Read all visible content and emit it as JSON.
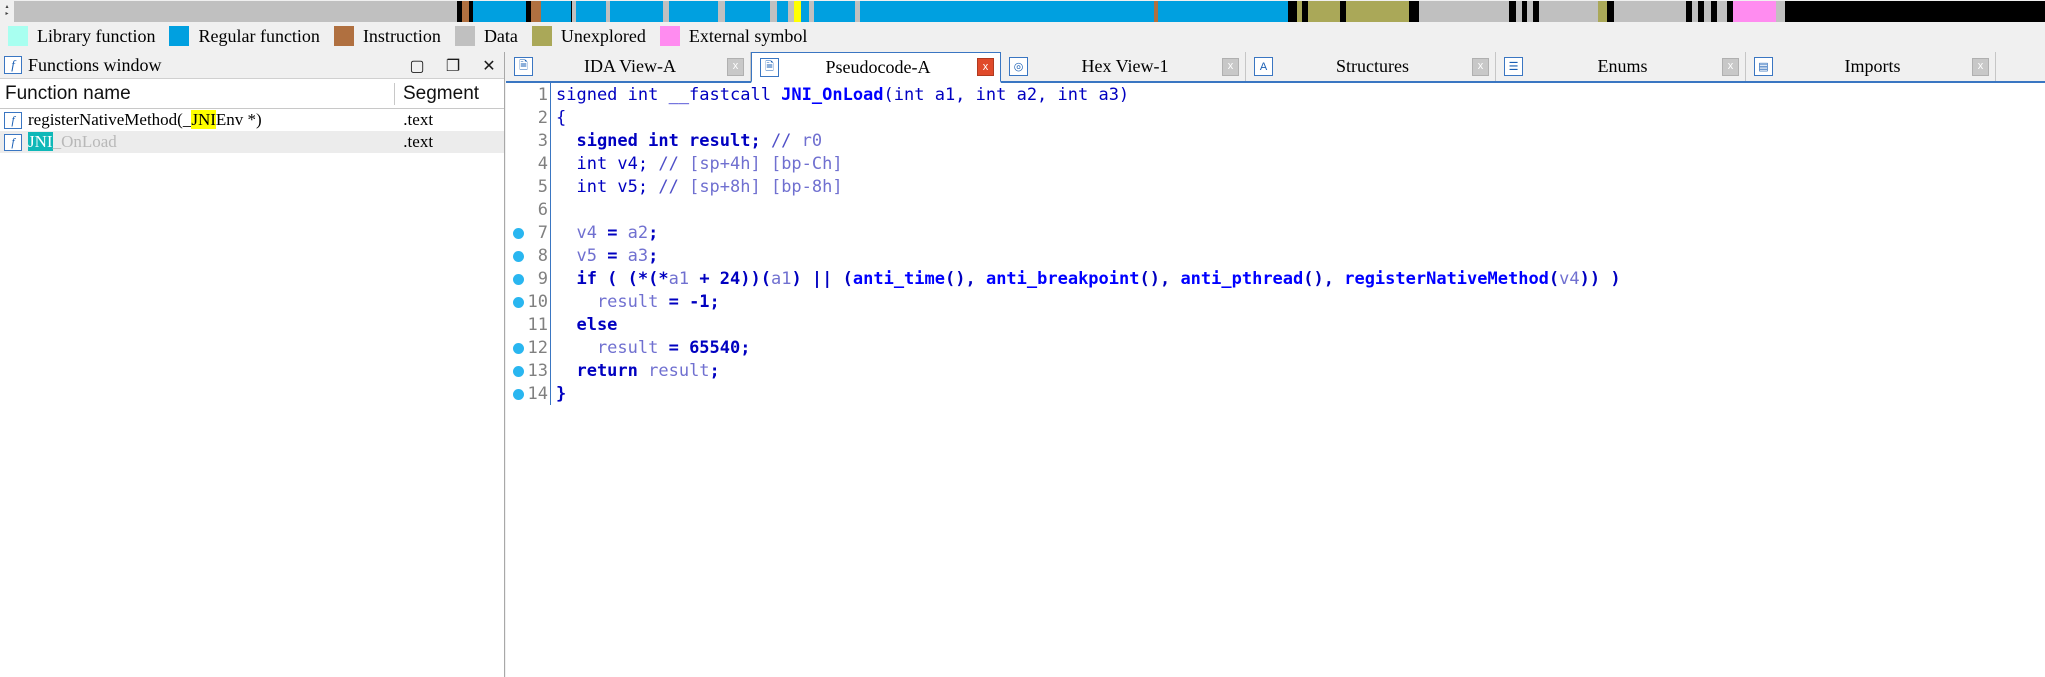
{
  "nav_band": {
    "name": "navigation-band",
    "background": "#000000",
    "cursor_marker_color": "#ffff00",
    "segments": [
      {
        "left_pct": 0.0,
        "width_pct": 21.8,
        "color": "#c0c0c0"
      },
      {
        "left_pct": 21.8,
        "width_pct": 0.25,
        "color": "#000000"
      },
      {
        "left_pct": 22.05,
        "width_pct": 0.35,
        "color": "#b07040"
      },
      {
        "left_pct": 22.4,
        "width_pct": 0.2,
        "color": "#000000"
      },
      {
        "left_pct": 22.6,
        "width_pct": 2.6,
        "color": "#00a0e0"
      },
      {
        "left_pct": 25.2,
        "width_pct": 0.25,
        "color": "#000000"
      },
      {
        "left_pct": 25.45,
        "width_pct": 0.5,
        "color": "#b07040"
      },
      {
        "left_pct": 25.95,
        "width_pct": 1.5,
        "color": "#00a0e0"
      },
      {
        "left_pct": 27.45,
        "width_pct": 0.2,
        "color": "#c0c0c0"
      },
      {
        "left_pct": 27.65,
        "width_pct": 1.5,
        "color": "#00a0e0"
      },
      {
        "left_pct": 29.15,
        "width_pct": 0.2,
        "color": "#c0c0c0"
      },
      {
        "left_pct": 29.35,
        "width_pct": 2.6,
        "color": "#00a0e0"
      },
      {
        "left_pct": 31.95,
        "width_pct": 0.3,
        "color": "#c0c0c0"
      },
      {
        "left_pct": 32.25,
        "width_pct": 2.4,
        "color": "#00a0e0"
      },
      {
        "left_pct": 34.65,
        "width_pct": 0.35,
        "color": "#c0c0c0"
      },
      {
        "left_pct": 35.0,
        "width_pct": 2.2,
        "color": "#00a0e0"
      },
      {
        "left_pct": 37.2,
        "width_pct": 0.35,
        "color": "#c0c0c0"
      },
      {
        "left_pct": 37.55,
        "width_pct": 0.55,
        "color": "#00a0e0"
      },
      {
        "left_pct": 38.1,
        "width_pct": 0.3,
        "color": "#c0c0c0"
      },
      {
        "left_pct": 38.4,
        "width_pct": 0.35,
        "color": "#ffff00"
      },
      {
        "left_pct": 38.75,
        "width_pct": 0.4,
        "color": "#00a0e0"
      },
      {
        "left_pct": 39.15,
        "width_pct": 0.25,
        "color": "#c0c0c0"
      },
      {
        "left_pct": 39.4,
        "width_pct": 2.0,
        "color": "#00a0e0"
      },
      {
        "left_pct": 41.4,
        "width_pct": 0.25,
        "color": "#c0c0c0"
      },
      {
        "left_pct": 41.65,
        "width_pct": 14.5,
        "color": "#00a0e0"
      },
      {
        "left_pct": 56.15,
        "width_pct": 0.2,
        "color": "#b07040"
      },
      {
        "left_pct": 56.35,
        "width_pct": 6.4,
        "color": "#00a0e0"
      },
      {
        "left_pct": 62.75,
        "width_pct": 0.4,
        "color": "#000000"
      },
      {
        "left_pct": 63.15,
        "width_pct": 0.25,
        "color": "#aaa858"
      },
      {
        "left_pct": 63.4,
        "width_pct": 0.3,
        "color": "#000000"
      },
      {
        "left_pct": 63.7,
        "width_pct": 1.6,
        "color": "#aaa858"
      },
      {
        "left_pct": 65.3,
        "width_pct": 0.3,
        "color": "#000000"
      },
      {
        "left_pct": 65.6,
        "width_pct": 3.1,
        "color": "#aaa858"
      },
      {
        "left_pct": 68.7,
        "width_pct": 0.5,
        "color": "#000000"
      },
      {
        "left_pct": 69.2,
        "width_pct": 4.4,
        "color": "#c0c0c0"
      },
      {
        "left_pct": 73.6,
        "width_pct": 0.35,
        "color": "#000000"
      },
      {
        "left_pct": 73.95,
        "width_pct": 0.3,
        "color": "#c0c0c0"
      },
      {
        "left_pct": 74.25,
        "width_pct": 0.25,
        "color": "#000000"
      },
      {
        "left_pct": 74.5,
        "width_pct": 0.3,
        "color": "#c0c0c0"
      },
      {
        "left_pct": 74.8,
        "width_pct": 0.3,
        "color": "#000000"
      },
      {
        "left_pct": 75.1,
        "width_pct": 2.9,
        "color": "#c0c0c0"
      },
      {
        "left_pct": 78.0,
        "width_pct": 0.45,
        "color": "#aaa858"
      },
      {
        "left_pct": 78.45,
        "width_pct": 0.35,
        "color": "#000000"
      },
      {
        "left_pct": 78.8,
        "width_pct": 3.5,
        "color": "#c0c0c0"
      },
      {
        "left_pct": 82.3,
        "width_pct": 0.3,
        "color": "#000000"
      },
      {
        "left_pct": 82.6,
        "width_pct": 0.3,
        "color": "#c0c0c0"
      },
      {
        "left_pct": 82.9,
        "width_pct": 0.3,
        "color": "#000000"
      },
      {
        "left_pct": 83.2,
        "width_pct": 0.35,
        "color": "#c0c0c0"
      },
      {
        "left_pct": 83.55,
        "width_pct": 0.3,
        "color": "#000000"
      },
      {
        "left_pct": 83.85,
        "width_pct": 0.5,
        "color": "#c0c0c0"
      },
      {
        "left_pct": 84.35,
        "width_pct": 0.3,
        "color": "#000000"
      },
      {
        "left_pct": 84.65,
        "width_pct": 2.1,
        "color": "#ff8cf0"
      },
      {
        "left_pct": 86.75,
        "width_pct": 0.45,
        "color": "#c0c0c0"
      },
      {
        "left_pct": 87.2,
        "width_pct": 12.8,
        "color": "#000000"
      }
    ],
    "scroll_up_glyph": "▴",
    "scroll_down_glyph": "▸"
  },
  "legend": {
    "name": "navigation-legend",
    "items": [
      {
        "label": "Library function",
        "color": "#a8fff0"
      },
      {
        "label": "Regular function",
        "color": "#00a0e0"
      },
      {
        "label": "Instruction",
        "color": "#b07040"
      },
      {
        "label": "Data",
        "color": "#c0c0c0"
      },
      {
        "label": "Unexplored",
        "color": "#aaa858"
      },
      {
        "label": "External symbol",
        "color": "#ff8cf0"
      }
    ]
  },
  "functions_window": {
    "title": "Functions window",
    "icon": "f",
    "buttons": {
      "maximize": "▢",
      "restore": "❐",
      "close": "✕"
    },
    "columns": [
      {
        "key": "name",
        "label": "Function name"
      },
      {
        "key": "segment",
        "label": "Segment"
      }
    ],
    "rows": [
      {
        "icon": "f",
        "name_parts": [
          {
            "text": "registerNativeMethod(_",
            "highlight": "none"
          },
          {
            "text": "JNI",
            "highlight": "yellow"
          },
          {
            "text": "Env *)",
            "highlight": "none"
          }
        ],
        "segment": ".text",
        "selected": false
      },
      {
        "icon": "f",
        "name_parts": [
          {
            "text": "JNI",
            "highlight": "teal"
          },
          {
            "text": "_OnLoad",
            "highlight": "dim"
          }
        ],
        "segment": ".text",
        "selected": true
      }
    ],
    "highlight_colors": {
      "yellow": "#ffff00",
      "teal": "#0fb8b8",
      "selected_row": "#ececec"
    }
  },
  "tabs": [
    {
      "label": "IDA View-A",
      "icon": "doc-icon",
      "active": false,
      "close": "x"
    },
    {
      "label": "Pseudocode-A",
      "icon": "doc-icon",
      "active": true,
      "close": "x"
    },
    {
      "label": "Hex View-1",
      "icon": "hex-icon",
      "active": false,
      "close": "x"
    },
    {
      "label": "Structures",
      "icon": "structures-icon",
      "active": false,
      "close": "x"
    },
    {
      "label": "Enums",
      "icon": "enums-icon",
      "active": false,
      "close": "x"
    },
    {
      "label": "Imports",
      "icon": "imports-icon",
      "active": false,
      "close": "x"
    }
  ],
  "pseudocode": {
    "name": "pseudocode-listing",
    "lines": [
      {
        "no": "1",
        "bp": false,
        "html": "<span class=\"k\">signed int __fastcall </span><span class=\"fn\">JNI_OnLoad</span><span class=\"k\">(int a1, int a2, int a3)</span>"
      },
      {
        "no": "2",
        "bp": false,
        "html": "<span class=\"k\">{</span>"
      },
      {
        "no": "3",
        "bp": false,
        "html": "<span class=\"kb\">  signed int result; </span><span class=\"cmt\">// </span><span class=\"var\">r0</span>"
      },
      {
        "no": "4",
        "bp": false,
        "html": "<span class=\"k\">  int v4; </span><span class=\"cmt\">// </span><span class=\"var\">[sp+4h] [bp-Ch]</span>"
      },
      {
        "no": "5",
        "bp": false,
        "html": "<span class=\"k\">  int v5; </span><span class=\"cmt\">// </span><span class=\"var\">[sp+8h] [bp-8h]</span>"
      },
      {
        "no": "6",
        "bp": false,
        "html": ""
      },
      {
        "no": "7",
        "bp": true,
        "html": "<span class=\"var\">  v4</span><span class=\"kb\"> = </span><span class=\"var\">a2</span><span class=\"kb\">;</span>"
      },
      {
        "no": "8",
        "bp": true,
        "html": "<span class=\"var\">  v5</span><span class=\"kb\"> = </span><span class=\"var\">a3</span><span class=\"kb\">;</span>"
      },
      {
        "no": "9",
        "bp": true,
        "html": "<span class=\"kb\">  if ( (*(*</span><span class=\"var\">a1</span><span class=\"kb\"> + 24))(</span><span class=\"var\">a1</span><span class=\"kb\">) || (</span><span class=\"fn\">anti_time</span><span class=\"kb\">(), </span><span class=\"fn\">anti_breakpoint</span><span class=\"kb\">(), </span><span class=\"fn\">anti_pthread</span><span class=\"kb\">(), </span><span class=\"fn\">registerNativeMethod</span><span class=\"kb\">(</span><span class=\"var\">v4</span><span class=\"kb\">)) )</span>"
      },
      {
        "no": "10",
        "bp": true,
        "html": "<span class=\"var\">    result</span><span class=\"kb\"> = -1;</span>"
      },
      {
        "no": "11",
        "bp": false,
        "html": "<span class=\"kb\">  else</span>"
      },
      {
        "no": "12",
        "bp": true,
        "html": "<span class=\"var\">    result</span><span class=\"kb\"> = 65540;</span>"
      },
      {
        "no": "13",
        "bp": true,
        "html": "<span class=\"kb\">  return </span><span class=\"var\">result</span><span class=\"kb\">;</span>"
      },
      {
        "no": "14",
        "bp": true,
        "html": "<span class=\"kb\">}</span>"
      }
    ],
    "breakpoint_color": "#29b6f0",
    "gutter_rule_color": "#3a76c2"
  }
}
